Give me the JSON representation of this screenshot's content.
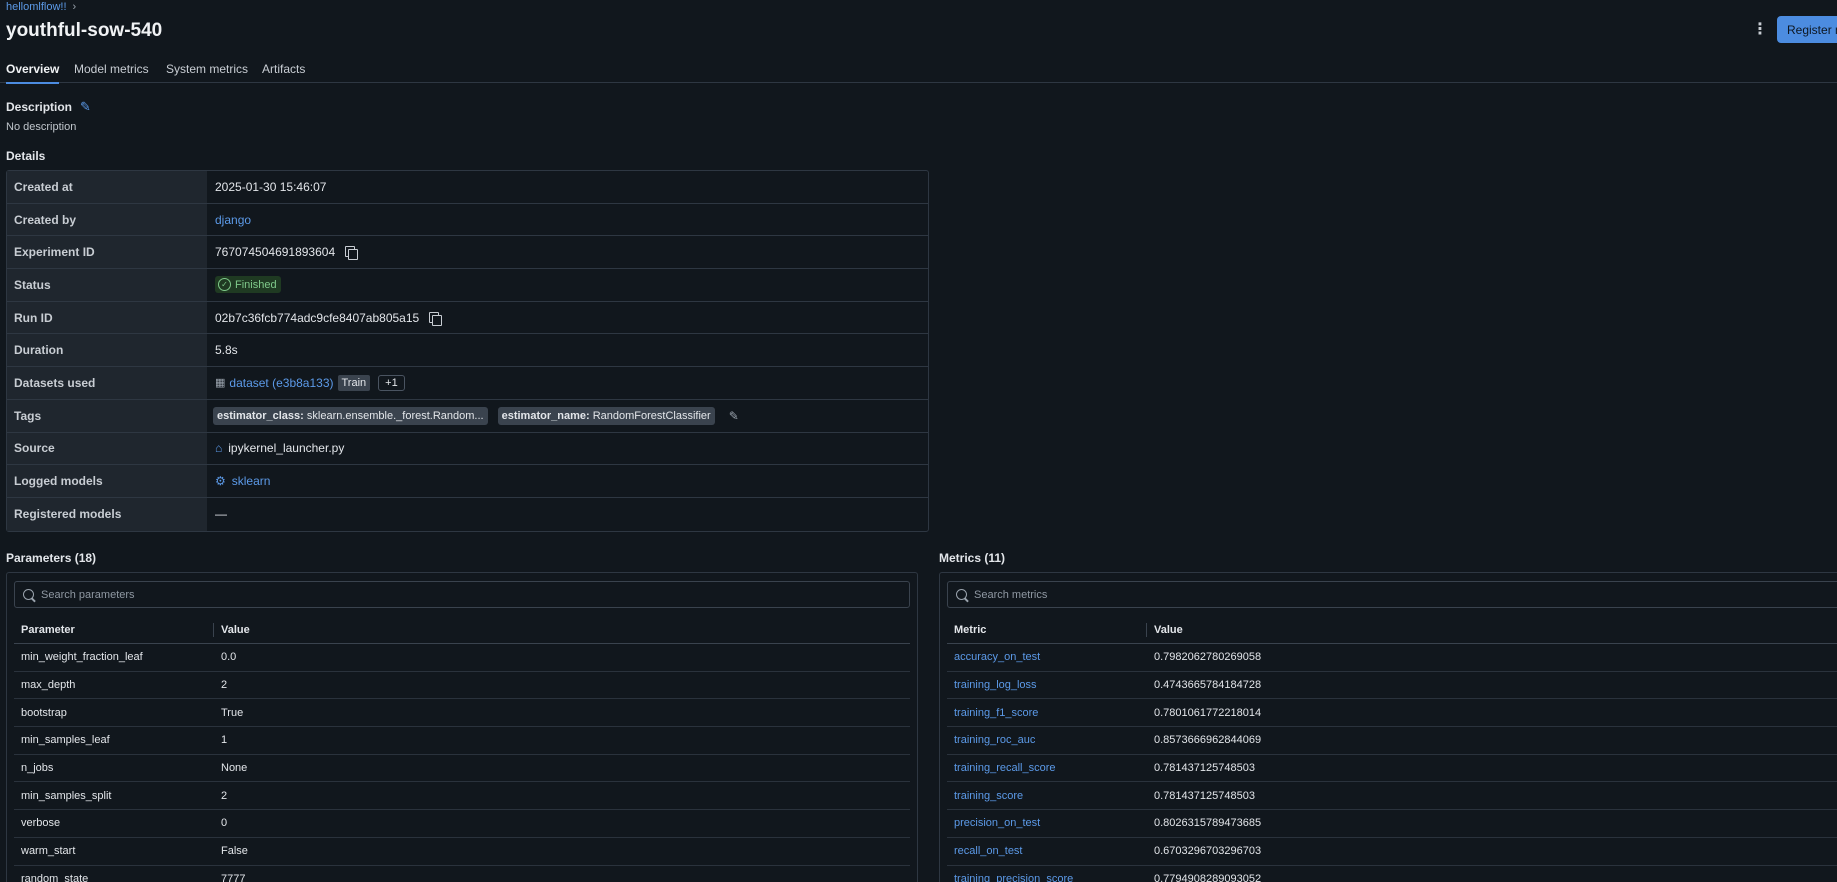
{
  "breadcrumb": {
    "experiment": "hellomlflow!!"
  },
  "run_name": "youthful-sow-540",
  "header": {
    "register_label": "Register model"
  },
  "tabs": [
    "Overview",
    "Model metrics",
    "System metrics",
    "Artifacts"
  ],
  "description": {
    "heading": "Description",
    "text": "No description"
  },
  "details": {
    "heading": "Details",
    "created_at": {
      "label": "Created at",
      "value": "2025-01-30 15:46:07"
    },
    "created_by": {
      "label": "Created by",
      "value": "django"
    },
    "experiment_id": {
      "label": "Experiment ID",
      "value": "767074504691893604"
    },
    "status": {
      "label": "Status",
      "value": "Finished"
    },
    "run_id": {
      "label": "Run ID",
      "value": "02b7c36fcb774adc9cfe8407ab805a15"
    },
    "duration": {
      "label": "Duration",
      "value": "5.8s"
    },
    "datasets": {
      "label": "Datasets used",
      "name": "dataset (e3b8a133)",
      "context": "Train",
      "more": "+1"
    },
    "tags": {
      "label": "Tags",
      "items": [
        {
          "key": "estimator_class:",
          "value": " sklearn.ensemble._forest.Random..."
        },
        {
          "key": "estimator_name:",
          "value": " RandomForestClassifier"
        }
      ]
    },
    "source": {
      "label": "Source",
      "value": "ipykernel_launcher.py"
    },
    "logged_models": {
      "label": "Logged models",
      "value": "sklearn"
    },
    "registered_models": {
      "label": "Registered models",
      "value": "—"
    }
  },
  "parameters": {
    "heading": "Parameters (18)",
    "search_placeholder": "Search parameters",
    "col_name": "Parameter",
    "col_value": "Value",
    "rows": [
      {
        "name": "min_weight_fraction_leaf",
        "value": "0.0"
      },
      {
        "name": "max_depth",
        "value": "2"
      },
      {
        "name": "bootstrap",
        "value": "True"
      },
      {
        "name": "min_samples_leaf",
        "value": "1"
      },
      {
        "name": "n_jobs",
        "value": "None"
      },
      {
        "name": "min_samples_split",
        "value": "2"
      },
      {
        "name": "verbose",
        "value": "0"
      },
      {
        "name": "warm_start",
        "value": "False"
      },
      {
        "name": "random_state",
        "value": "7777"
      }
    ]
  },
  "metrics": {
    "heading": "Metrics (11)",
    "search_placeholder": "Search metrics",
    "col_name": "Metric",
    "col_value": "Value",
    "rows": [
      {
        "name": "accuracy_on_test",
        "value": "0.7982062780269058"
      },
      {
        "name": "training_log_loss",
        "value": "0.4743665784184728"
      },
      {
        "name": "training_f1_score",
        "value": "0.7801061772218014"
      },
      {
        "name": "training_roc_auc",
        "value": "0.8573666962844069"
      },
      {
        "name": "training_recall_score",
        "value": "0.781437125748503"
      },
      {
        "name": "training_score",
        "value": "0.781437125748503"
      },
      {
        "name": "precision_on_test",
        "value": "0.8026315789473685"
      },
      {
        "name": "recall_on_test",
        "value": "0.6703296703296703"
      },
      {
        "name": "training_precision_score",
        "value": "0.7794908289093052"
      }
    ]
  }
}
